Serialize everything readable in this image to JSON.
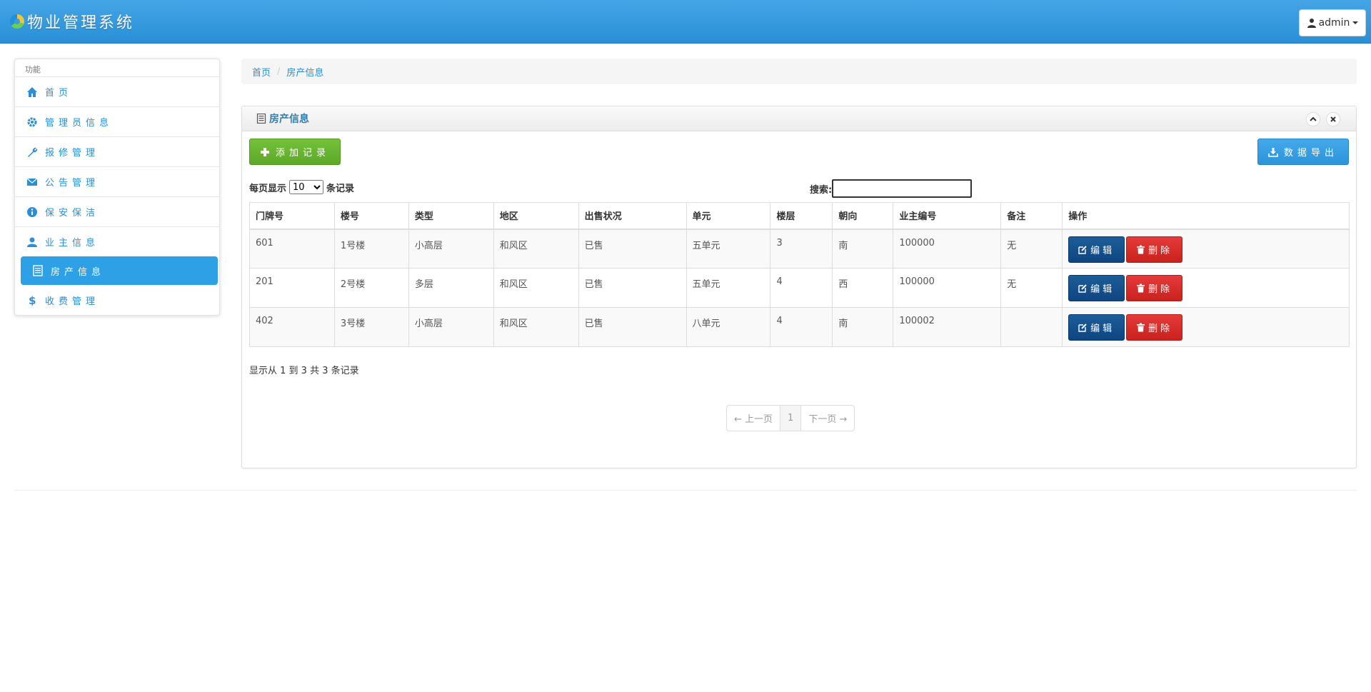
{
  "header": {
    "title": "物业管理系统",
    "user_label": "admin"
  },
  "sidebar": {
    "caption": "功能",
    "items": [
      {
        "label": "首页",
        "icon": "home-icon"
      },
      {
        "label": "管理员信息",
        "icon": "gear-icon"
      },
      {
        "label": "报修管理",
        "icon": "wrench-icon"
      },
      {
        "label": "公告管理",
        "icon": "envelope-icon"
      },
      {
        "label": "保安保洁",
        "icon": "info-icon"
      },
      {
        "label": "业主信息",
        "icon": "user-icon"
      },
      {
        "label": "房产信息",
        "icon": "list-icon",
        "active": true
      },
      {
        "label": "收费管理",
        "icon": "dollar-icon"
      }
    ]
  },
  "breadcrumb": {
    "home": "首页",
    "current": "房产信息"
  },
  "panel": {
    "title": "房产信息",
    "add_label": "添加记录",
    "export_label": "数据导出",
    "length_prefix": "每页显示",
    "length_value": "10",
    "length_options": [
      "10"
    ],
    "length_suffix": "条记录",
    "search_label": "搜索:",
    "search_value": ""
  },
  "table": {
    "columns": [
      "门牌号",
      "楼号",
      "类型",
      "地区",
      "出售状况",
      "单元",
      "楼层",
      "朝向",
      "业主编号",
      "备注",
      "操作"
    ],
    "rows": [
      [
        "601",
        "1号楼",
        "小高层",
        "和风区",
        "已售",
        "五单元",
        "3",
        "南",
        "100000",
        "无"
      ],
      [
        "201",
        "2号楼",
        "多层",
        "和风区",
        "已售",
        "五单元",
        "4",
        "西",
        "100000",
        "无"
      ],
      [
        "402",
        "3号楼",
        "小高层",
        "和风区",
        "已售",
        "八单元",
        "4",
        "南",
        "100002",
        ""
      ]
    ],
    "edit_label": "编辑",
    "delete_label": "删除"
  },
  "info": "显示从 1 到 3 共 3 条记录",
  "pager": {
    "prev": "← 上一页",
    "page": "1",
    "next": "下一页 →"
  },
  "colors": {
    "header_blue": "#2a8fd6",
    "add_green": "#5ea92a",
    "edit_blue": "#0e4580",
    "delete_red": "#c9211c"
  }
}
